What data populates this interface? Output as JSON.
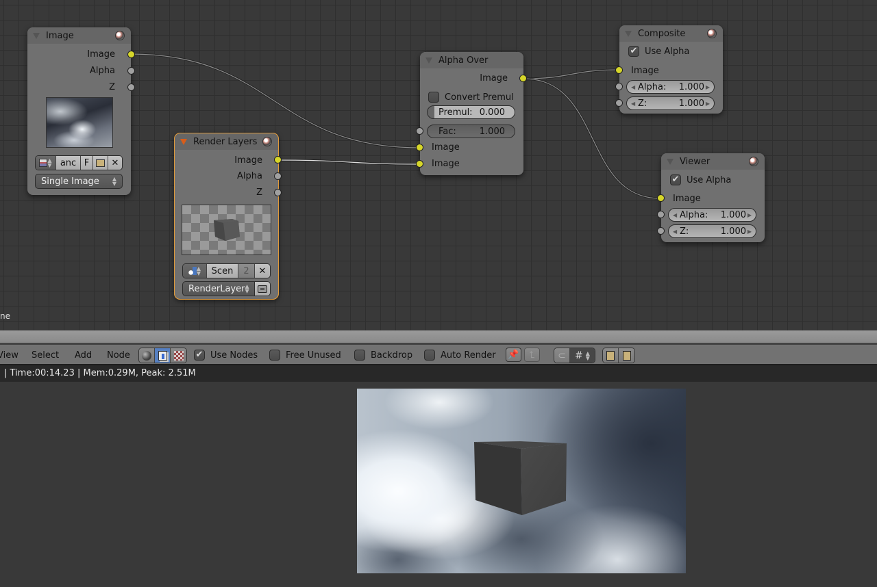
{
  "nodes": {
    "image": {
      "title": "Image",
      "outputs": [
        "Image",
        "Alpha",
        "Z"
      ],
      "image_name": "anc",
      "fake_user": "F",
      "source": "Single Image"
    },
    "render_layers": {
      "title": "Render Layers",
      "outputs": [
        "Image",
        "Alpha",
        "Z"
      ],
      "scene_name": "Scen",
      "users": "2",
      "layer": "RenderLayer"
    },
    "alpha_over": {
      "title": "Alpha Over",
      "output": "Image",
      "convert_premul_label": "Convert Premul",
      "convert_premul_checked": false,
      "premul_label": "Premul:",
      "premul_value": "0.000",
      "fac_label": "Fac:",
      "fac_value": "1.000",
      "inputs": [
        "Image",
        "Image"
      ]
    },
    "composite": {
      "title": "Composite",
      "use_alpha_label": "Use Alpha",
      "use_alpha_checked": true,
      "input_image": "Image",
      "alpha_label": "Alpha:",
      "alpha_value": "1.000",
      "z_label": "Z:",
      "z_value": "1.000"
    },
    "viewer": {
      "title": "Viewer",
      "use_alpha_label": "Use Alpha",
      "use_alpha_checked": true,
      "input_image": "Image",
      "alpha_label": "Alpha:",
      "alpha_value": "1.000",
      "z_label": "Z:",
      "z_value": "1.000"
    }
  },
  "editor_side_text": "ne",
  "toolbar": {
    "menus": [
      "View",
      "Select",
      "Add",
      "Node"
    ],
    "tree_types": [
      "shader-node-icon",
      "compositing-node-icon",
      "texture-node-icon"
    ],
    "active_tree_type": "compositing-node-icon",
    "use_nodes_label": "Use Nodes",
    "use_nodes_checked": true,
    "free_unused_label": "Free Unused",
    "free_unused_checked": false,
    "backdrop_label": "Backdrop",
    "backdrop_checked": false,
    "auto_render_label": "Auto Render",
    "auto_render_checked": false
  },
  "status": "| Time:00:14.23 | Mem:0.29M, Peak: 2.51M",
  "colors": {
    "socket_image": "#d6d62a",
    "socket_value": "#a0a0a0",
    "active_node_outline": "#e09a3a",
    "active_toggle": "#5680c2"
  }
}
